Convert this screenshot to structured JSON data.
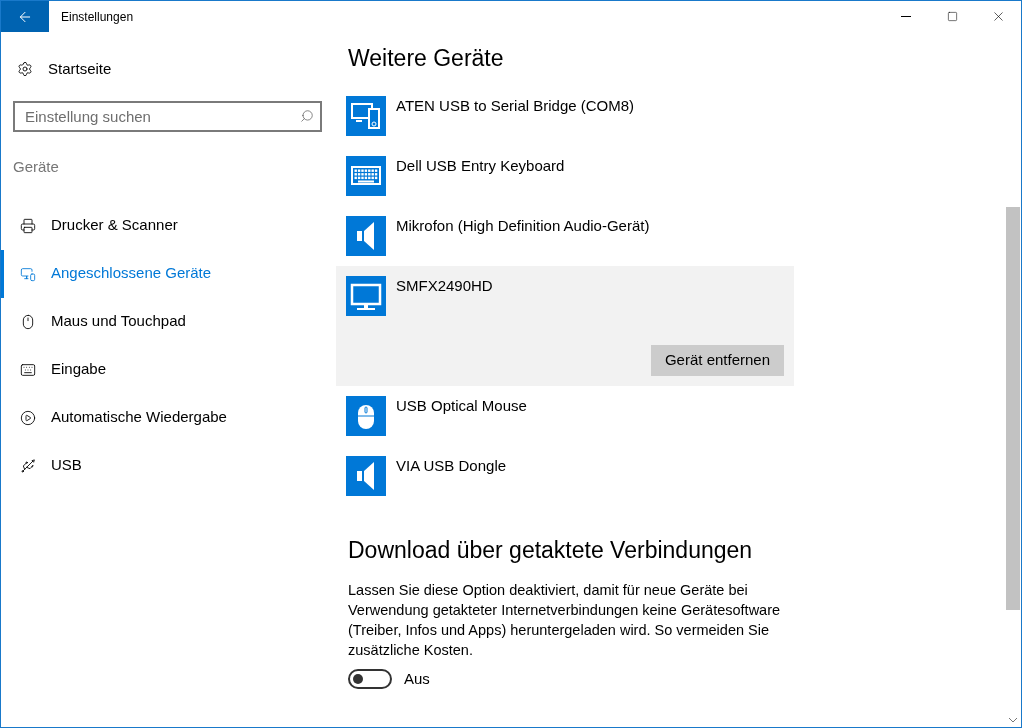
{
  "window": {
    "title": "Einstellungen"
  },
  "sidebar": {
    "home": "Startseite",
    "search": {
      "placeholder": "Einstellung suchen"
    },
    "section": "Geräte",
    "items": [
      {
        "label": "Drucker & Scanner",
        "kind": "printer",
        "selected": false
      },
      {
        "label": "Angeschlossene Geräte",
        "kind": "devices",
        "selected": true
      },
      {
        "label": "Maus und Touchpad",
        "kind": "mouse",
        "selected": false
      },
      {
        "label": "Eingabe",
        "kind": "keyboard",
        "selected": false
      },
      {
        "label": "Automatische Wiedergabe",
        "kind": "autoplay",
        "selected": false
      },
      {
        "label": "USB",
        "kind": "usb",
        "selected": false
      }
    ]
  },
  "devices": {
    "heading": "Weitere Geräte",
    "remove_button": "Gerät entfernen",
    "items": [
      {
        "name": "ATEN USB to Serial Bridge (COM8)",
        "kind": "devices",
        "selected": false
      },
      {
        "name": "Dell USB Entry Keyboard",
        "kind": "keyboard",
        "selected": false
      },
      {
        "name": "Mikrofon (High Definition Audio-Gerät)",
        "kind": "speaker",
        "selected": false
      },
      {
        "name": "SMFX2490HD",
        "kind": "monitor",
        "selected": true
      },
      {
        "name": "USB Optical Mouse",
        "kind": "mouse",
        "selected": false
      },
      {
        "name": "VIA USB Dongle",
        "kind": "speaker",
        "selected": false
      }
    ]
  },
  "metered": {
    "heading": "Download über getaktete Verbindungen",
    "description": "Lassen Sie diese Option deaktiviert, damit für neue Geräte bei Verwendung getakteter Internetverbindungen keine Gerätesoftware (Treiber, Infos und Apps) heruntergeladen wird. So vermeiden Sie zusätzliche Kosten.",
    "toggle": {
      "on": false,
      "label": "Aus"
    }
  }
}
